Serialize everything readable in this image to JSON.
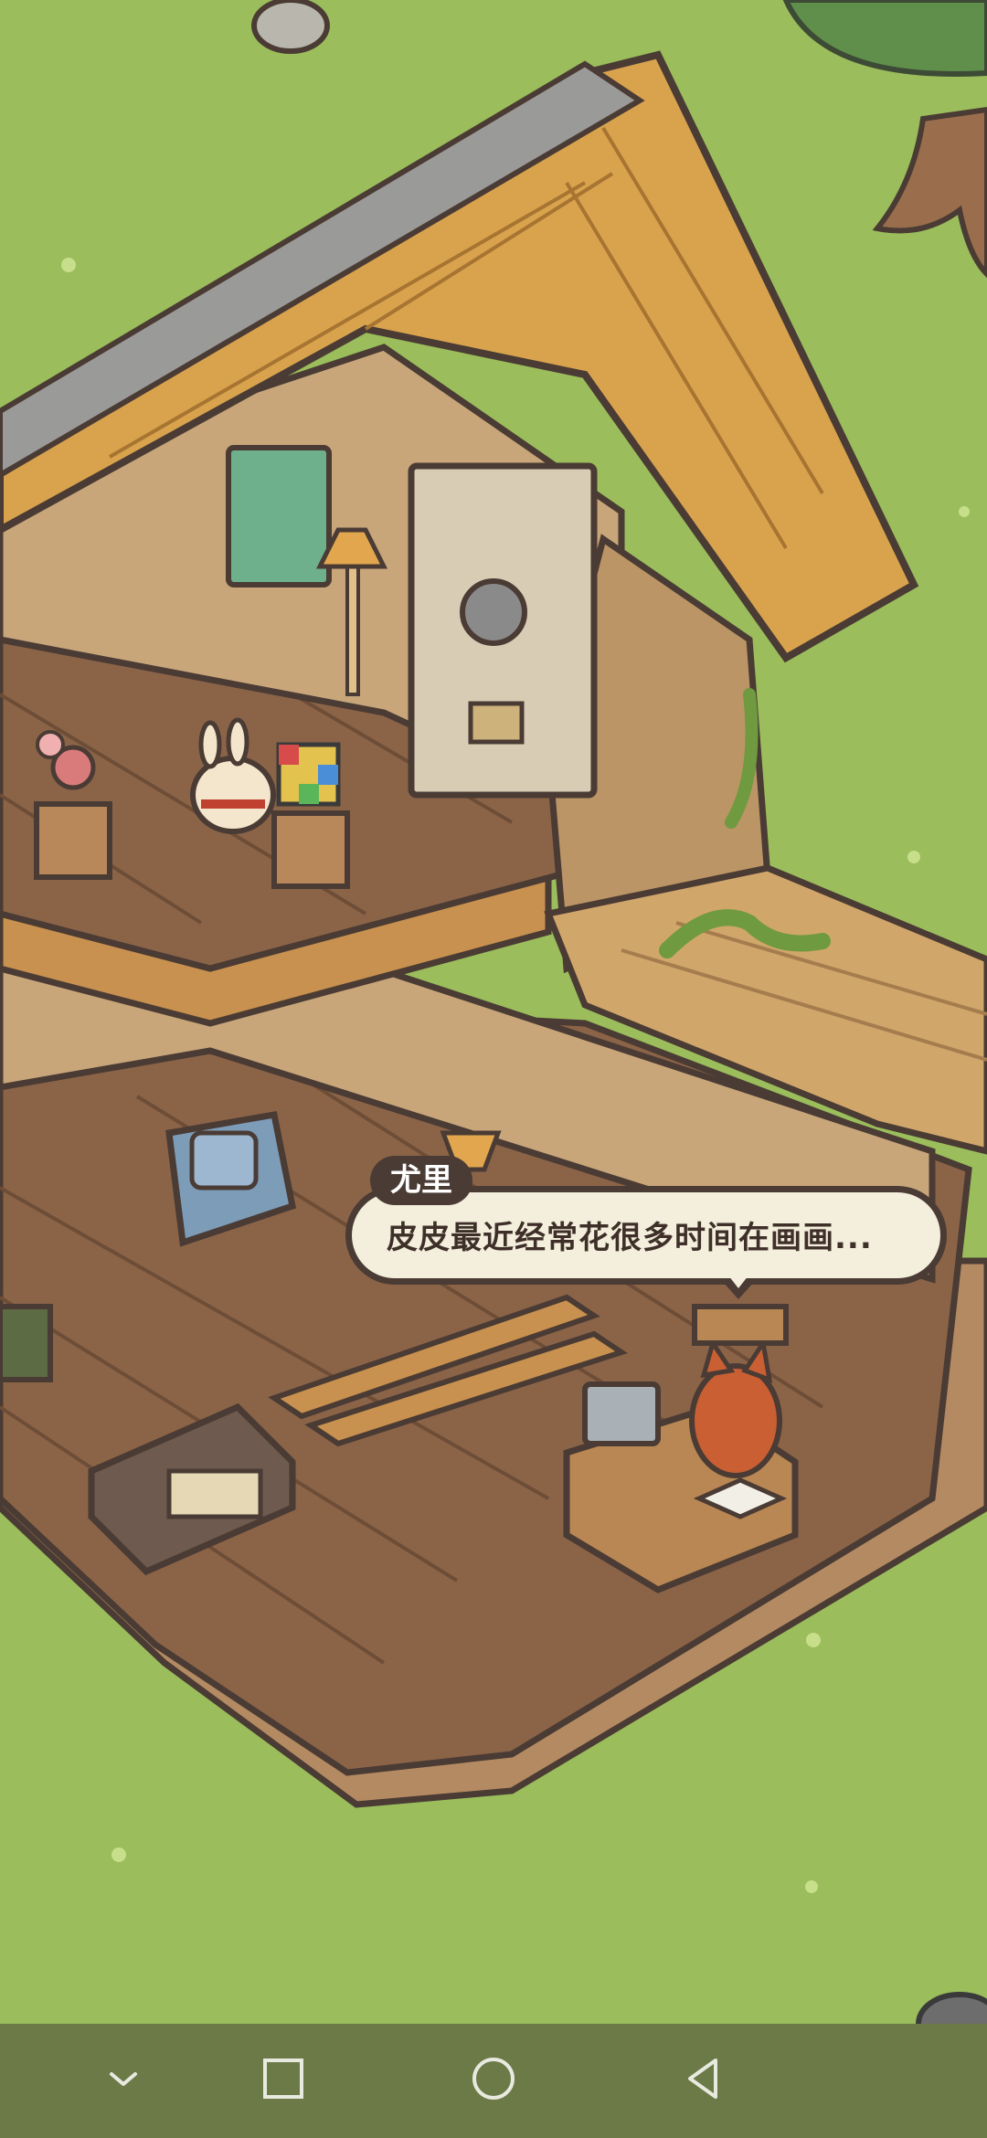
{
  "dialog": {
    "speaker": "尤里",
    "text": "皮皮最近经常花很多时间在画画..."
  },
  "nav": {
    "icons": [
      "chevron-down-icon",
      "square-recents-icon",
      "circle-home-icon",
      "triangle-back-icon"
    ]
  },
  "colors": {
    "grass": "#9bbd5c",
    "roof": "#d9a34e",
    "floor": "#8b6448",
    "wall": "#c8a67a",
    "outline": "#4a3b34",
    "bubble": "#f4eedd",
    "navbar": "#6b7a47"
  }
}
